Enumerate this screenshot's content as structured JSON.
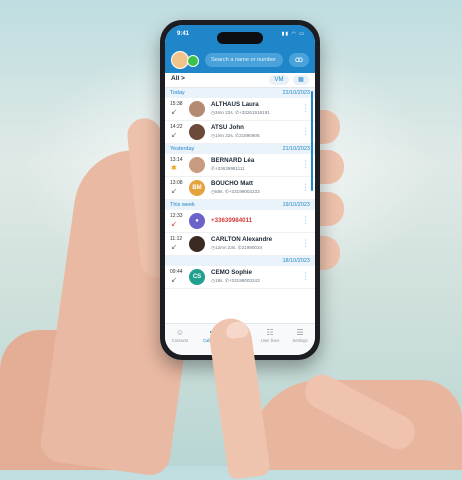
{
  "status": {
    "time": "9:41"
  },
  "header": {
    "search_placeholder": "Search a name or number",
    "voicemail_icon": "voicemail-icon"
  },
  "filter": {
    "label": "All",
    "chevron": ">",
    "pill1": "VM",
    "pill2_icon": "calendar-icon"
  },
  "sections": [
    {
      "label": "Today",
      "date": "22/10/2023"
    },
    {
      "label": "Yesterday",
      "date": "21/10/2023"
    },
    {
      "label": "This week",
      "date": "19/10/2023"
    },
    {
      "label": "",
      "date": "18/10/2023"
    }
  ],
  "calls": [
    {
      "time": "15:38",
      "name": "ALTHAUS Laura",
      "duration": "3mn 22s.",
      "number": "+33261916191",
      "direction": "incoming"
    },
    {
      "time": "14:22",
      "name": "ATSU John",
      "duration": "1mn 22s.",
      "number": "21890906",
      "direction": "incoming"
    },
    {
      "time": "13:14",
      "name": "BERNARD Léa",
      "duration": "",
      "number": "+33639981111",
      "direction": "missed"
    },
    {
      "time": "13:08",
      "name": "BOUCHO Matt",
      "initials": "BM",
      "duration": "58s.",
      "number": "+33199003233",
      "direction": "incoming"
    },
    {
      "time": "12:33",
      "name": "+33639984011",
      "duration": "",
      "number": "",
      "direction": "missed"
    },
    {
      "time": "11:12",
      "name": "CARLTON Alexandre",
      "duration": "12mn 23s.",
      "number": "21990034",
      "direction": "incoming"
    },
    {
      "time": "09:44",
      "name": "CEMO Sophie",
      "initials": "CS",
      "duration": "18s.",
      "number": "+33199003243",
      "direction": "incoming"
    }
  ],
  "nav": [
    {
      "label": "Contacts",
      "icon": "contacts-icon"
    },
    {
      "label": "Call log",
      "icon": "call-log-icon"
    },
    {
      "label": "",
      "icon": "keypad-icon"
    },
    {
      "label": "User lines",
      "icon": "user-lines-icon"
    },
    {
      "label": "Settings",
      "icon": "settings-icon"
    }
  ],
  "colors": {
    "brand": "#1f86c9",
    "presence": "#3cc24b",
    "missed": "#d43a3a"
  }
}
